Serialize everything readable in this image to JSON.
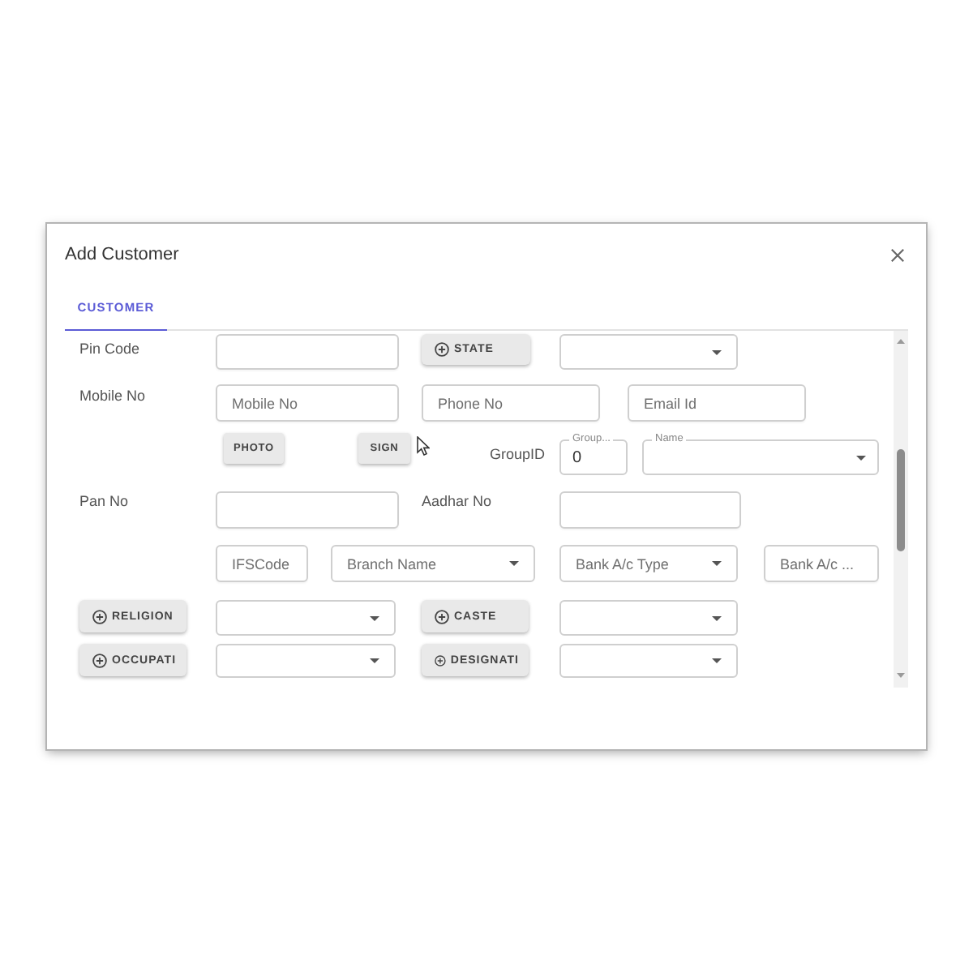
{
  "dialog": {
    "title": "Add Customer",
    "tabs": [
      {
        "label": "CUSTOMER",
        "selected": true
      }
    ],
    "rows": [
      {
        "items": [
          {
            "kind": "label",
            "text": "Pin Code"
          },
          {
            "kind": "input"
          },
          {
            "kind": "add-button",
            "label": "STATE"
          },
          {
            "kind": "select"
          }
        ]
      },
      {
        "items": [
          {
            "kind": "label",
            "text": "Mobile No"
          },
          {
            "kind": "input",
            "placeholder": "Mobile No"
          },
          {
            "kind": "input",
            "placeholder": "Phone No"
          },
          {
            "kind": "input",
            "placeholder": "Email Id"
          }
        ]
      },
      {
        "items": [
          {
            "kind": "upload-button",
            "label": "PHOTO"
          },
          {
            "kind": "upload-button",
            "label": "SIGN"
          },
          {
            "kind": "label",
            "text": "GroupID"
          },
          {
            "kind": "outlined-input",
            "label": "Group...",
            "value": "0"
          },
          {
            "kind": "outlined-select",
            "label": "Name"
          }
        ]
      },
      {
        "items": [
          {
            "kind": "label",
            "text": "Pan No"
          },
          {
            "kind": "input"
          },
          {
            "kind": "label",
            "text": "Aadhar No"
          },
          {
            "kind": "input"
          }
        ]
      },
      {
        "items": [
          {
            "kind": "input",
            "placeholder": "IFSCode"
          },
          {
            "kind": "select",
            "placeholder": "Branch Name"
          },
          {
            "kind": "select",
            "placeholder": "Bank A/c Type"
          },
          {
            "kind": "input",
            "placeholder": "Bank A/c ..."
          }
        ]
      },
      {
        "items": [
          {
            "kind": "add-button",
            "label": "RELIGION"
          },
          {
            "kind": "select"
          },
          {
            "kind": "add-button",
            "label": "CASTE"
          },
          {
            "kind": "select"
          }
        ]
      },
      {
        "items": [
          {
            "kind": "add-button",
            "label": "OCCUPATI"
          },
          {
            "kind": "select"
          },
          {
            "kind": "add-button",
            "label": "DESIGNATI"
          },
          {
            "kind": "select"
          }
        ]
      }
    ]
  }
}
